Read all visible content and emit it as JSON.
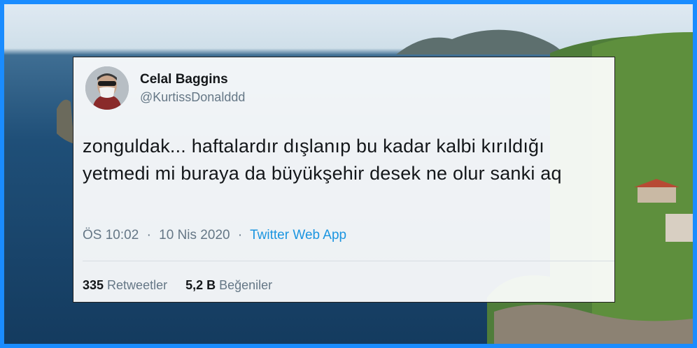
{
  "tweet": {
    "author_name": "Celal Baggins",
    "author_handle": "@KurtissDonalddd",
    "text": "zonguldak... haftalardır dışlanıp bu kadar kalbi kırıldığı yetmedi mi buraya da büyükşehir desek ne olur sanki aq",
    "time": "ÖS 10:02",
    "separator": "·",
    "date": "10 Nis 2020",
    "source": "Twitter Web App",
    "retweets_count": "335",
    "retweets_label": "Retweetler",
    "likes_count": "5,2 B",
    "likes_label": "Beğeniler"
  },
  "colors": {
    "frame_border": "#1a8cff",
    "link": "#1b95e0",
    "secondary_text": "#657786",
    "primary_text": "#14171a"
  }
}
